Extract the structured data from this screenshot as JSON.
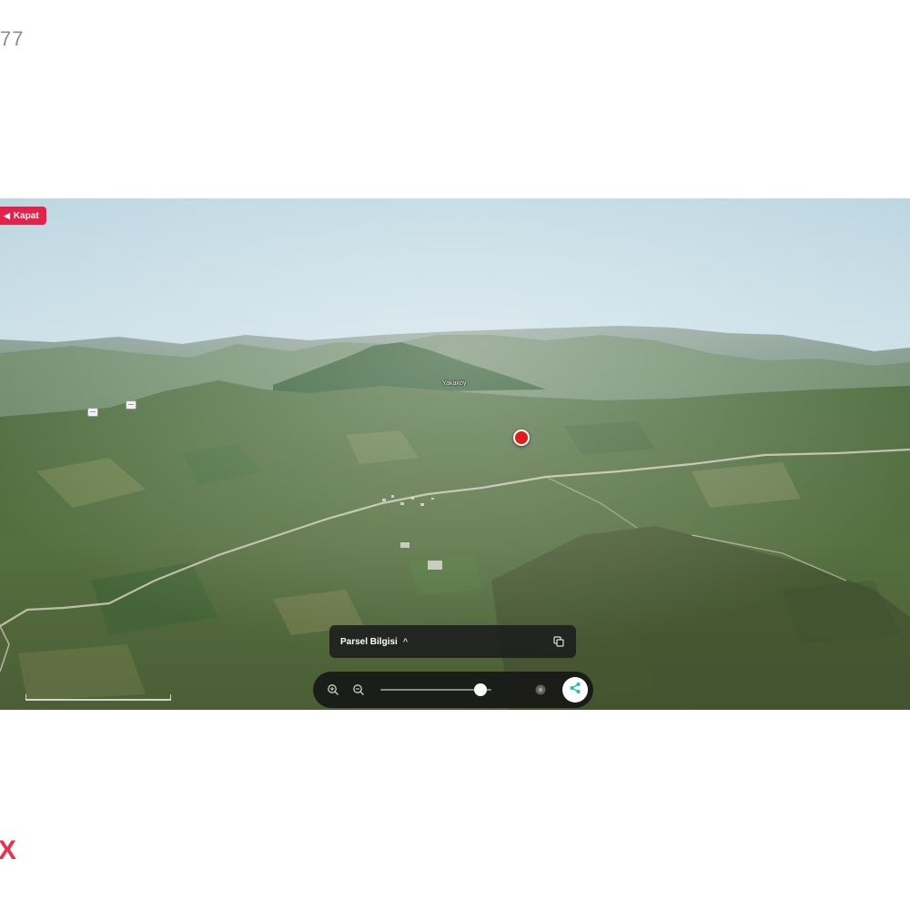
{
  "page": {
    "corner_text": "77",
    "corner_mark": "X"
  },
  "badge": {
    "label": "Kapat",
    "icon": "arrow-left-icon",
    "color": "#e5214a"
  },
  "map": {
    "labels": [
      {
        "text": "Yakaköy"
      }
    ],
    "road_shields": [
      "—",
      "—"
    ],
    "marker": {
      "icon": "location-pin-icon",
      "color": "#e21b1b"
    }
  },
  "info_panel": {
    "title": "Parsel Bilgisi",
    "expand_icon": "chevron-up-icon",
    "copy_icon": "copy-icon"
  },
  "toolbar": {
    "zoom_in_icon": "zoom-in-icon",
    "zoom_out_icon": "zoom-out-icon",
    "slider_value": 0.9,
    "compass_icon": "compass-icon",
    "share_icon": "share-icon",
    "share_color": "#1fbfa4"
  }
}
